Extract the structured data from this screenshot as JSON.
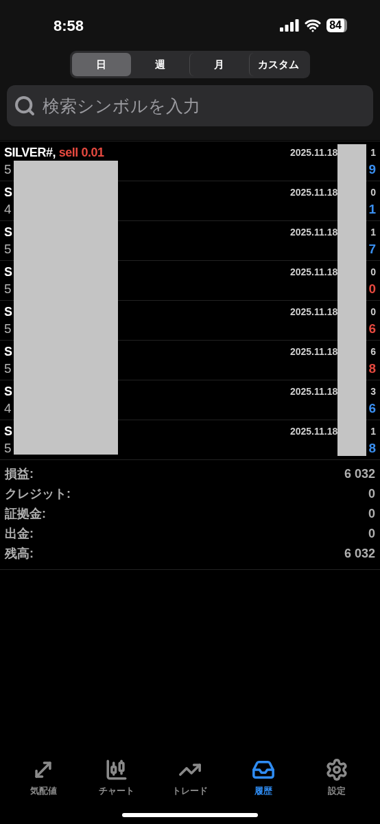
{
  "status_bar": {
    "time": "8:58",
    "battery": "84"
  },
  "period_tabs": [
    {
      "label": "日",
      "selected": true
    },
    {
      "label": "週",
      "selected": false
    },
    {
      "label": "月",
      "selected": false
    },
    {
      "label": "カスタム",
      "selected": false
    }
  ],
  "search": {
    "placeholder": "検索シンボルを入力"
  },
  "deals": [
    {
      "symbol": "SILVER#,",
      "order": "sell 0.01",
      "price": "5",
      "date": "2025.11.18",
      "time_end": "1",
      "profit_end": "9",
      "color": "#3a8ff0"
    },
    {
      "symbol": "S",
      "price": "4",
      "date": "2025.11.18",
      "time_end": "0",
      "profit_end": "1",
      "color": "#3a8ff0"
    },
    {
      "symbol": "S",
      "price": "5",
      "date": "2025.11.18",
      "time_end": "1",
      "profit_end": "7",
      "color": "#3a8ff0"
    },
    {
      "symbol": "S",
      "price": "5",
      "date": "2025.11.18",
      "time_end": "0",
      "profit_end": "0",
      "color": "#e5493f"
    },
    {
      "symbol": "S",
      "price": "5",
      "date": "2025.11.18",
      "time_end": "0",
      "profit_end": "6",
      "color": "#e5493f"
    },
    {
      "symbol": "S",
      "price": "5",
      "date": "2025.11.18",
      "time_end": "6",
      "profit_end": "8",
      "color": "#e5493f"
    },
    {
      "symbol": "S",
      "price": "4",
      "date": "2025.11.18",
      "time_end": "3",
      "profit_end": "6",
      "color": "#3a8ff0"
    },
    {
      "symbol": "S",
      "price": "5",
      "date": "2025.11.18",
      "time_end": "1",
      "profit_end": "8",
      "color": "#3a8ff0"
    }
  ],
  "summary": [
    {
      "label": "損益:",
      "value": "6 032"
    },
    {
      "label": "クレジット:",
      "value": "0"
    },
    {
      "label": "証拠金:",
      "value": "0"
    },
    {
      "label": "出金:",
      "value": "0"
    },
    {
      "label": "残高:",
      "value": "6 032"
    }
  ],
  "tab_bar": [
    {
      "kind": "quotes",
      "label": "気配値",
      "selected": false
    },
    {
      "kind": "chart",
      "label": "チャート",
      "selected": false
    },
    {
      "kind": "trade",
      "label": "トレード",
      "selected": false
    },
    {
      "kind": "history",
      "label": "履歴",
      "selected": true
    },
    {
      "kind": "settings",
      "label": "設定",
      "selected": false
    }
  ]
}
